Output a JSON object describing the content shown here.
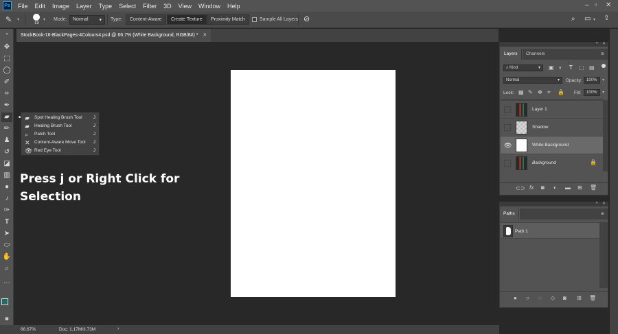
{
  "app": {
    "logo": "Ps",
    "menu": [
      "File",
      "Edit",
      "Image",
      "Layer",
      "Type",
      "Select",
      "Filter",
      "3D",
      "View",
      "Window",
      "Help"
    ],
    "window_controls": [
      "minimize-icon",
      "maximize-icon",
      "close-icon"
    ]
  },
  "options": {
    "brush_size": "19",
    "mode_label": "Mode:",
    "mode_value": "Normal",
    "type_label": "Type:",
    "type_buttons": [
      "Content-Aware",
      "Create Texture",
      "Proximity Match"
    ],
    "type_selected": "Create Texture",
    "sample_all_layers": "Sample All Layers"
  },
  "document": {
    "tab_title": "StockBook-16-BlackPages-4Colours4.psd @ 66.7% (White Background, RGB/8#) *"
  },
  "flyout": {
    "items": [
      {
        "label": "Spot Healing Brush Tool",
        "key": "J",
        "selected": true
      },
      {
        "label": "Healing Brush Tool",
        "key": "J"
      },
      {
        "label": "Patch Tool",
        "key": "J"
      },
      {
        "label": "Content-Aware Move Tool",
        "key": "J"
      },
      {
        "label": "Red Eye Tool",
        "key": "J"
      }
    ]
  },
  "overlay": {
    "line1": "Press j or Right Click for",
    "line2": "Selection"
  },
  "status": {
    "zoom": "66.67%",
    "doc": "Doc: 1.17M/3.73M"
  },
  "layers_panel": {
    "tabs": [
      "Layers",
      "Channels"
    ],
    "kind": "Kind",
    "blend_mode": "Normal",
    "opacity_label": "Opacity:",
    "opacity_value": "100%",
    "lock_label": "Lock:",
    "fill_label": "Fill:",
    "fill_value": "100%",
    "layers": [
      {
        "name": "Layer 1",
        "visible": false
      },
      {
        "name": "Shadow",
        "visible": false
      },
      {
        "name": "White Background",
        "visible": true,
        "selected": true
      },
      {
        "name": "Background",
        "visible": false,
        "locked": true
      }
    ]
  },
  "paths_panel": {
    "title": "Paths",
    "paths": [
      {
        "name": "Path 1"
      }
    ]
  },
  "colors": {
    "chrome": "#535353",
    "workspace": "#282828",
    "canvas": "#ffffff",
    "foreground_swatch": "#1e6b6b",
    "selected_layer": "#6a6a6a"
  }
}
